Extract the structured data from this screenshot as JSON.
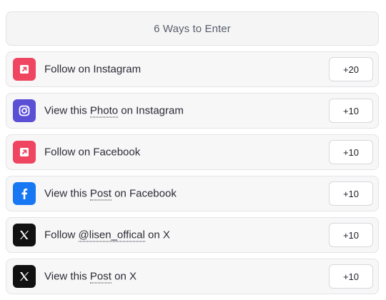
{
  "header": {
    "title": "6 Ways to Enter"
  },
  "colors": {
    "instagram_follow": "#ef4561",
    "instagram_photo": "#5b4fd6",
    "facebook_follow": "#ef4561",
    "facebook_post": "#1877f2",
    "x": "#111111"
  },
  "entries": [
    {
      "icon": "external-link-icon",
      "label_pre": "Follow on Instagram",
      "label_link": "",
      "label_post": "",
      "points": "+20"
    },
    {
      "icon": "instagram-icon",
      "label_pre": "View this ",
      "label_link": "Photo",
      "label_post": " on Instagram",
      "points": "+10"
    },
    {
      "icon": "external-link-icon",
      "label_pre": "Follow on Facebook",
      "label_link": "",
      "label_post": "",
      "points": "+10"
    },
    {
      "icon": "facebook-icon",
      "label_pre": "View this ",
      "label_link": "Post",
      "label_post": " on Facebook",
      "points": "+10"
    },
    {
      "icon": "x-logo-icon",
      "label_pre": "Follow ",
      "label_link": "@lisen_offical",
      "label_post": " on X",
      "points": "+10"
    },
    {
      "icon": "x-logo-icon",
      "label_pre": "View this ",
      "label_link": "Post",
      "label_post": " on X",
      "points": "+10"
    }
  ]
}
